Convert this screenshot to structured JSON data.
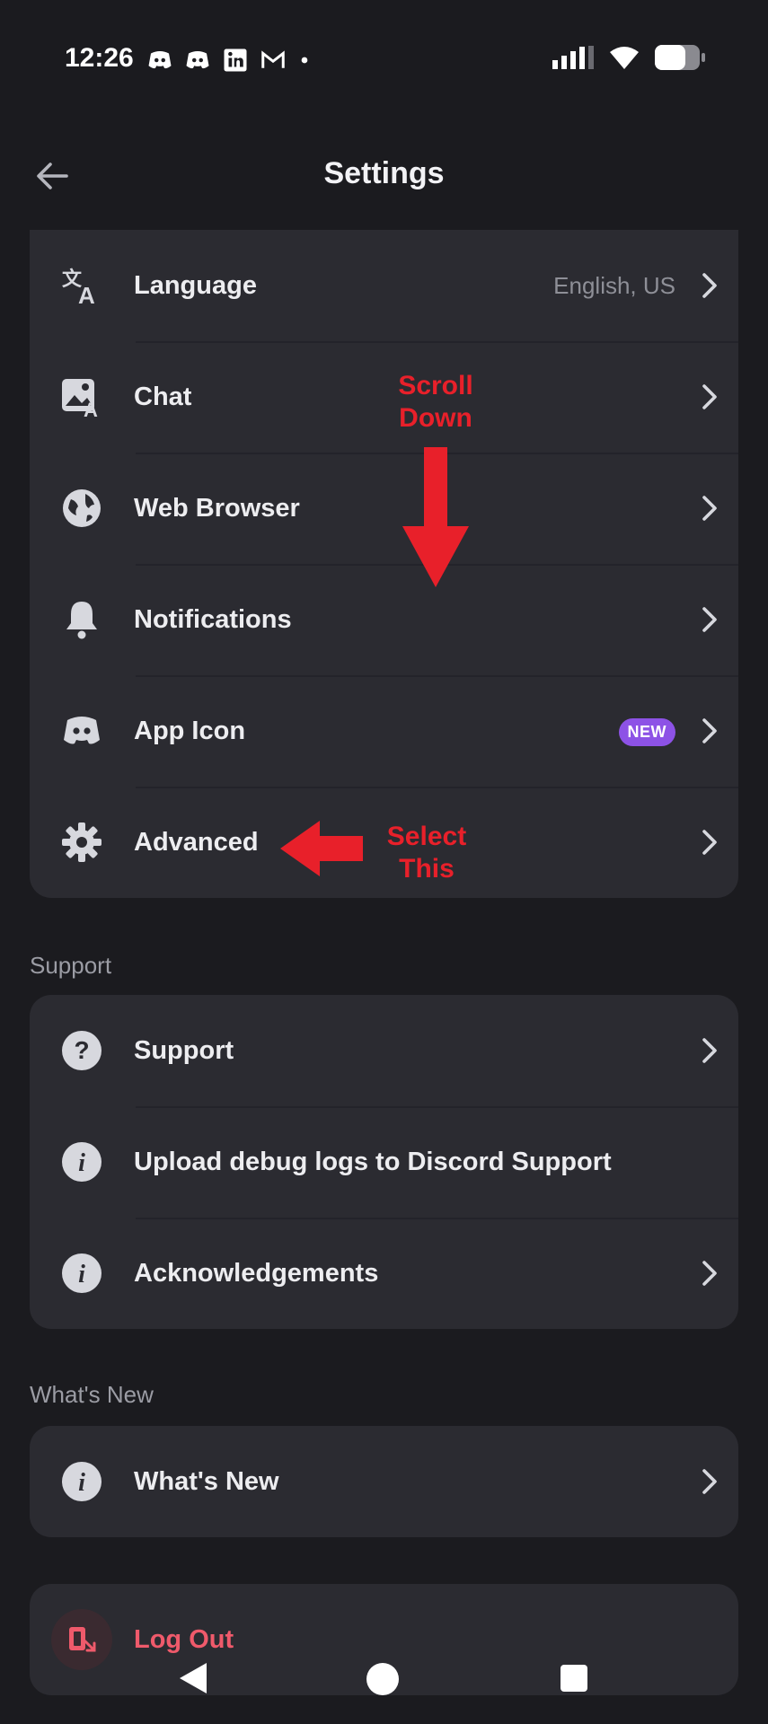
{
  "status": {
    "time": "12:26",
    "notification_icons": [
      "discord-icon",
      "discord-icon",
      "linkedin-icon",
      "gmail-icon",
      "dot-icon"
    ],
    "signal_icon": "signal-icon",
    "wifi_icon": "wifi-icon",
    "battery_icon": "battery-icon"
  },
  "header": {
    "title": "Settings",
    "back_icon": "back-arrow-icon"
  },
  "app_settings": {
    "items": [
      {
        "label": "Language",
        "value": "English, US",
        "icon": "language-icon"
      },
      {
        "label": "Chat",
        "icon": "chat-image-icon"
      },
      {
        "label": "Web Browser",
        "icon": "globe-icon"
      },
      {
        "label": "Notifications",
        "icon": "bell-icon"
      },
      {
        "label": "App Icon",
        "badge": "NEW",
        "icon": "discord-icon"
      },
      {
        "label": "Advanced",
        "icon": "gear-icon"
      }
    ]
  },
  "support": {
    "section_title": "Support",
    "items": [
      {
        "label": "Support",
        "icon": "question-icon"
      },
      {
        "label": "Upload debug logs to Discord Support",
        "icon": "info-icon"
      },
      {
        "label": "Acknowledgements",
        "icon": "info-icon"
      }
    ]
  },
  "whats_new": {
    "section_title": "What's New",
    "items": [
      {
        "label": "What's New",
        "icon": "info-icon"
      }
    ]
  },
  "logout": {
    "label": "Log Out",
    "icon": "logout-icon"
  },
  "annotations": {
    "scroll_down": "Scroll\nDown",
    "select_this": "Select\nThis"
  },
  "colors": {
    "background": "#1b1b1f",
    "card": "#2b2b31",
    "accent_red": "#e8202a",
    "logout": "#ef5a6b",
    "badge": "#8d52e6"
  }
}
